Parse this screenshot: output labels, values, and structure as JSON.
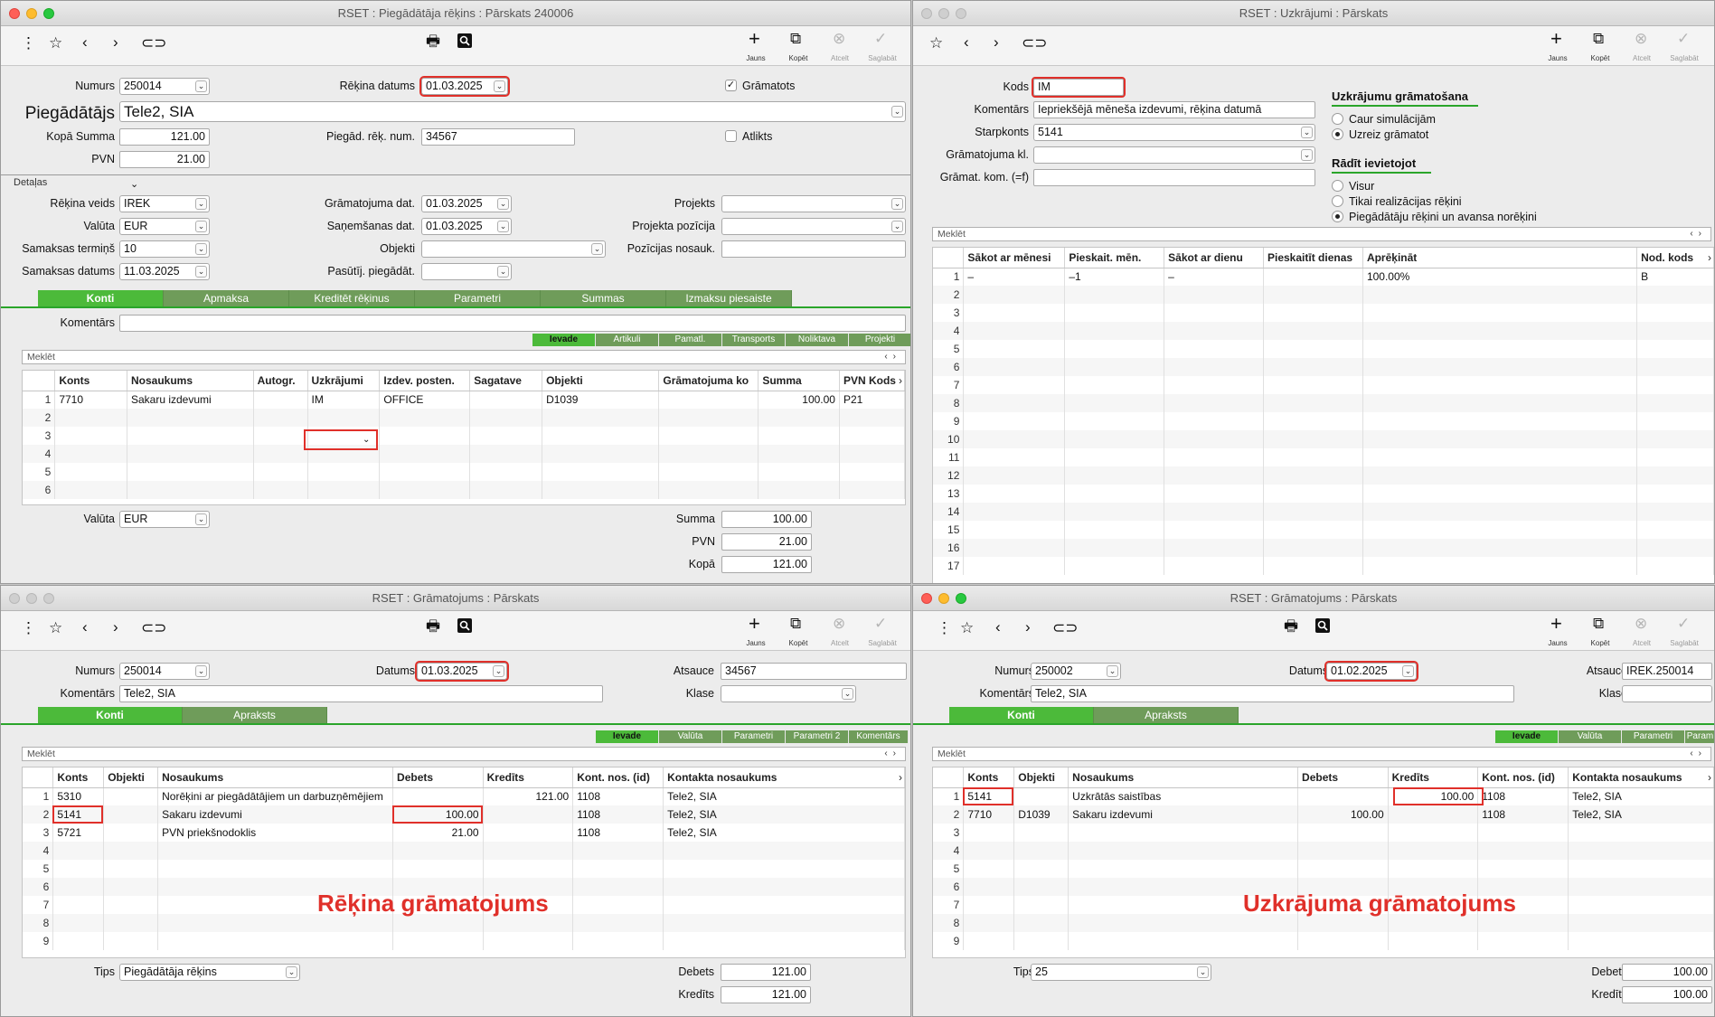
{
  "toolbar_labels": {
    "new": "Jauns",
    "copy": "Kopēt",
    "cancel": "Atcelt",
    "save": "Saglabāt"
  },
  "search_placeholder": "Meklēt",
  "w1": {
    "title": "RSET : Piegādātāja rēķins : Pārskats 240006",
    "numurs_label": "Numurs",
    "numurs": "250014",
    "rekina_datums_label": "Rēķina datums",
    "rekina_datums": "01.03.2025",
    "gramatots_label": "Grāmatots",
    "piegadatajs_label": "Piegādātājs",
    "piegadatajs": "Tele2, SIA",
    "kopa_summa_label": "Kopā Summa",
    "kopa_summa": "121.00",
    "pvn_label": "PVN",
    "pvn": "21.00",
    "pieg_rek_num_label": "Piegād. rēķ. num.",
    "pieg_rek_num": "34567",
    "atlikts_label": "Atlikts",
    "detalas_label": "Detaļas",
    "rekina_veids_label": "Rēķina veids",
    "rekina_veids": "IREK",
    "valuta_label": "Valūta",
    "valuta": "EUR",
    "samaksas_termins_label": "Samaksas termiņš",
    "samaksas_termins": "10",
    "samaksas_datums_label": "Samaksas datums",
    "samaksas_datums": "11.03.2025",
    "gramatojuma_dat_label": "Grāmatojuma dat.",
    "gramatojuma_dat": "01.03.2025",
    "sanemsanas_dat_label": "Saņemšanas dat.",
    "sanemsanas_dat": "01.03.2025",
    "objekti_label": "Objekti",
    "pasutij_label": "Pasūtīj. piegādāt.",
    "projekts_label": "Projekts",
    "projekta_pozicija_label": "Projekta pozīcija",
    "pozicijas_nosauk_label": "Pozīcijas nosauk.",
    "tabs": [
      "Konti",
      "Apmaksa",
      "Kreditēt rēķinus",
      "Parametri",
      "Summas",
      "Izmaksu piesaiste"
    ],
    "komentars_label": "Komentārs",
    "subtabs": [
      "Ievade",
      "Artikuli",
      "Pamatl.",
      "Transports",
      "Noliktava",
      "Projekti"
    ],
    "columns": [
      "Konts",
      "Nosaukums",
      "Autogr.",
      "Uzkrājumi",
      "Izdev. posten.",
      "Sagatave",
      "Objekti",
      "Grāmatojuma ko",
      "Summa",
      "PVN Kods"
    ],
    "rows": [
      [
        "1",
        "7710",
        "Sakaru izdevumi",
        "",
        "IM",
        "OFFICE",
        "",
        "D1039",
        "",
        "100.00",
        "P21"
      ],
      [
        "2",
        "",
        "",
        "",
        "",
        "",
        "",
        "",
        "",
        "",
        ""
      ],
      [
        "3",
        "",
        "",
        "",
        "",
        "",
        "",
        "",
        "",
        "",
        ""
      ],
      [
        "4",
        "",
        "",
        "",
        "",
        "",
        "",
        "",
        "",
        "",
        ""
      ],
      [
        "5",
        "",
        "",
        "",
        "",
        "",
        "",
        "",
        "",
        "",
        ""
      ],
      [
        "6",
        "",
        "",
        "",
        "",
        "",
        "",
        "",
        "",
        "",
        ""
      ]
    ],
    "bottom_valuta_label": "Valūta",
    "bottom_valuta": "EUR",
    "summa_label": "Summa",
    "summa": "100.00",
    "bottom_pvn_label": "PVN",
    "bottom_pvn": "21.00",
    "kopa_label": "Kopā",
    "kopa": "121.00"
  },
  "w2": {
    "title": "RSET : Uzkrājumi : Pārskats",
    "kods_label": "Kods",
    "kods": "IM",
    "komentars_label": "Komentārs",
    "komentars": "Iepriekšējā mēneša izdevumi, rēķina datumā",
    "starpkonts_label": "Starpkonts",
    "starpkonts": "5141",
    "gramatojuma_kl_label": "Grāmatojuma kl.",
    "gramat_kom_label": "Grāmat. kom. (=f)",
    "uzkr_gramatosana_head": "Uzkrājumu grāmatošana",
    "radio_caur": "Caur simulācijām",
    "radio_uzreiz": "Uzreiz grāmatot",
    "radit_head": "Rādīt ievietojot",
    "radio_visur": "Visur",
    "radio_tikai": "Tikai realizācijas rēķini",
    "radio_pieg": "Piegādātāju rēķini un avansa norēķini",
    "columns": [
      "Sākot ar mēnesi",
      "Pieskait. mēn.",
      "Sākot ar dienu",
      "Pieskaitīt dienas",
      "Aprēķināt",
      "Nod. kods"
    ],
    "rows": [
      [
        "1",
        "–",
        "–1",
        "–",
        "",
        "100.00%",
        "B"
      ],
      [
        "2",
        "",
        "",
        "",
        "",
        "",
        ""
      ],
      [
        "3",
        "",
        "",
        "",
        "",
        "",
        ""
      ],
      [
        "4",
        "",
        "",
        "",
        "",
        "",
        ""
      ],
      [
        "5",
        "",
        "",
        "",
        "",
        "",
        ""
      ],
      [
        "6",
        "",
        "",
        "",
        "",
        "",
        ""
      ],
      [
        "7",
        "",
        "",
        "",
        "",
        "",
        ""
      ],
      [
        "8",
        "",
        "",
        "",
        "",
        "",
        ""
      ],
      [
        "9",
        "",
        "",
        "",
        "",
        "",
        ""
      ],
      [
        "10",
        "",
        "",
        "",
        "",
        "",
        ""
      ],
      [
        "11",
        "",
        "",
        "",
        "",
        "",
        ""
      ],
      [
        "12",
        "",
        "",
        "",
        "",
        "",
        ""
      ],
      [
        "13",
        "",
        "",
        "",
        "",
        "",
        ""
      ],
      [
        "14",
        "",
        "",
        "",
        "",
        "",
        ""
      ],
      [
        "15",
        "",
        "",
        "",
        "",
        "",
        ""
      ],
      [
        "16",
        "",
        "",
        "",
        "",
        "",
        ""
      ],
      [
        "17",
        "",
        "",
        "",
        "",
        "",
        ""
      ]
    ]
  },
  "w3": {
    "title": "RSET : Grāmatojums : Pārskats",
    "numurs_label": "Numurs",
    "numurs": "250014",
    "datums_label": "Datums",
    "datums": "01.03.2025",
    "atsauce_label": "Atsauce",
    "atsauce": "34567",
    "komentars_label": "Komentārs",
    "komentars": "Tele2, SIA",
    "klase_label": "Klase",
    "tabs": [
      "Konti",
      "Apraksts"
    ],
    "subtabs": [
      "Ievade",
      "Valūta",
      "Parametri",
      "Parametri 2",
      "Komentārs"
    ],
    "columns": [
      "Konts",
      "Objekti",
      "Nosaukums",
      "Debets",
      "Kredīts",
      "Kont. nos. (id)",
      "Kontakta nosaukums"
    ],
    "rows": [
      [
        "1",
        "5310",
        "",
        "Norēķini ar piegādātājiem un darbuzņēmējiem",
        "",
        "121.00",
        "1108",
        "Tele2, SIA"
      ],
      [
        "2",
        "5141",
        "",
        "Sakaru izdevumi",
        "100.00",
        "",
        "1108",
        "Tele2, SIA"
      ],
      [
        "3",
        "5721",
        "",
        "PVN priekšnodoklis",
        "21.00",
        "",
        "1108",
        "Tele2, SIA"
      ],
      [
        "4",
        "",
        "",
        "",
        "",
        "",
        "",
        ""
      ],
      [
        "5",
        "",
        "",
        "",
        "",
        "",
        "",
        ""
      ],
      [
        "6",
        "",
        "",
        "",
        "",
        "",
        "",
        ""
      ],
      [
        "7",
        "",
        "",
        "",
        "",
        "",
        "",
        ""
      ],
      [
        "8",
        "",
        "",
        "",
        "",
        "",
        "",
        ""
      ],
      [
        "9",
        "",
        "",
        "",
        "",
        "",
        "",
        ""
      ]
    ],
    "overlay": "Rēķina grāmatojums",
    "tips_label": "Tips",
    "tips": "Piegādātāja rēķins",
    "debets_label": "Debets",
    "debets": "121.00",
    "kredits_label": "Kredīts",
    "kredits": "121.00"
  },
  "w4": {
    "title": "RSET : Grāmatojums : Pārskats",
    "numurs_label": "Numurs",
    "numurs": "250002",
    "datums_label": "Datums",
    "datums": "01.02.2025",
    "atsauce_label": "Atsauce",
    "atsauce": "IREK.250014",
    "komentars_label": "Komentārs",
    "komentars": "Tele2, SIA",
    "klase_label": "Klase",
    "tabs": [
      "Konti",
      "Apraksts"
    ],
    "subtabs": [
      "Ievade",
      "Valūta",
      "Parametri",
      "Param"
    ],
    "columns": [
      "Konts",
      "Objekti",
      "Nosaukums",
      "Debets",
      "Kredīts",
      "Kont. nos. (id)",
      "Kontakta nosaukums"
    ],
    "rows": [
      [
        "1",
        "5141",
        "",
        "Uzkrātās saistības",
        "",
        "100.00",
        "1108",
        "Tele2, SIA"
      ],
      [
        "2",
        "7710",
        "D1039",
        "Sakaru izdevumi",
        "100.00",
        "",
        "1108",
        "Tele2, SIA"
      ],
      [
        "3",
        "",
        "",
        "",
        "",
        "",
        "",
        ""
      ],
      [
        "4",
        "",
        "",
        "",
        "",
        "",
        "",
        ""
      ],
      [
        "5",
        "",
        "",
        "",
        "",
        "",
        "",
        ""
      ],
      [
        "6",
        "",
        "",
        "",
        "",
        "",
        "",
        ""
      ],
      [
        "7",
        "",
        "",
        "",
        "",
        "",
        "",
        ""
      ],
      [
        "8",
        "",
        "",
        "",
        "",
        "",
        "",
        ""
      ],
      [
        "9",
        "",
        "",
        "",
        "",
        "",
        "",
        ""
      ]
    ],
    "overlay": "Uzkrājuma grāmatojums",
    "tips_label": "Tips",
    "tips": "25",
    "debets_label": "Debets",
    "debets": "100.00",
    "kredits_label": "Kredīts",
    "kredits": "100.00"
  }
}
